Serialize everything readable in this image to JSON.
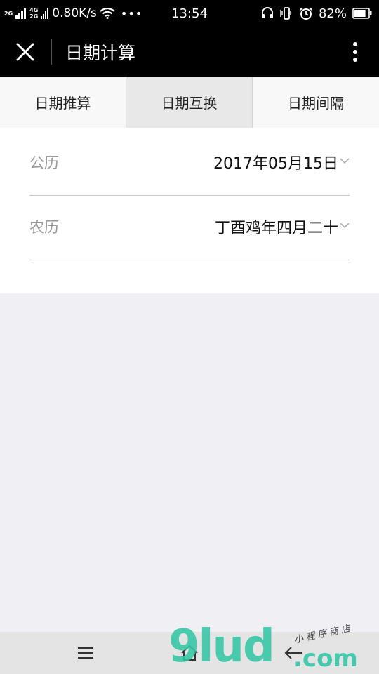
{
  "status_bar": {
    "signal1_label": "2G",
    "signal2_label_top": "4G",
    "signal2_label_bottom": "2G",
    "speed": "0.80K/s",
    "more_dots": "•••",
    "time": "13:54",
    "battery_percent": "82%",
    "battery_level": 0.82
  },
  "nav": {
    "title": "日期计算"
  },
  "tabs": [
    {
      "label": "日期推算",
      "active": false
    },
    {
      "label": "日期互换",
      "active": true
    },
    {
      "label": "日期间隔",
      "active": false
    }
  ],
  "form": {
    "gregorian_label": "公历",
    "gregorian_value": "2017年05月15日",
    "lunar_label": "农历",
    "lunar_value": "丁酉鸡年四月二十"
  },
  "watermark": {
    "main": "9lud",
    "tld": ".com",
    "sub": "小程序商店"
  },
  "colors": {
    "header_bg": "#000000",
    "page_bg": "#efeff4",
    "watermark_accent": "#35c7a6"
  }
}
